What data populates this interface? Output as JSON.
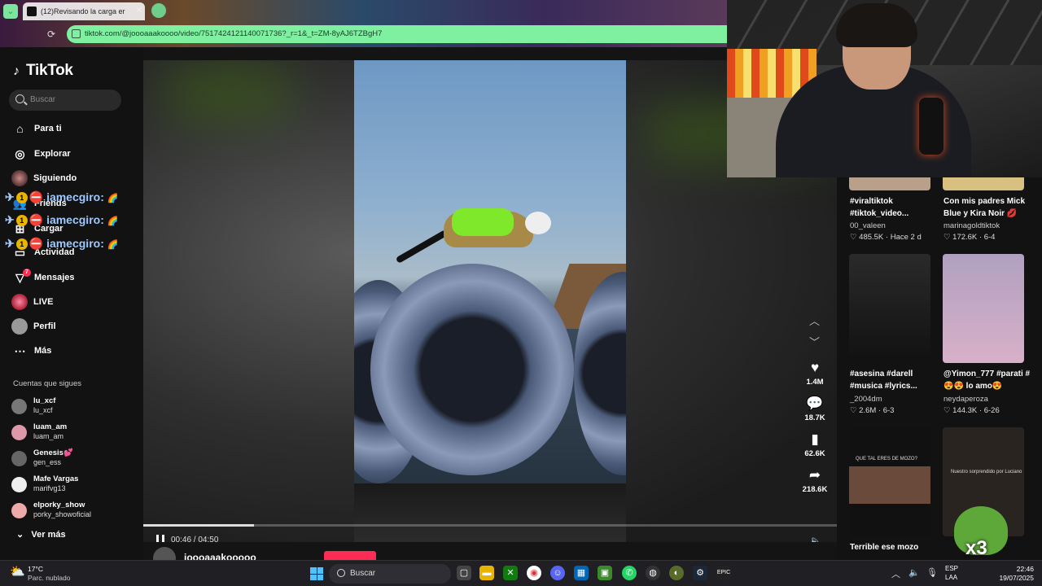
{
  "browser": {
    "tab_title": "(12)Revisando la carga er",
    "url": "tiktok.com/@joooaaakoooo/video/7517424121140071736?_r=1&_t=ZM-8yAJ6TZBgH7"
  },
  "sidebar": {
    "logo": "TikTok",
    "search_placeholder": "Buscar",
    "nav": [
      {
        "label": "Para ti",
        "icon": "home-icon"
      },
      {
        "label": "Explorar",
        "icon": "compass-icon"
      },
      {
        "label": "Siguiendo",
        "icon": "following-avatar"
      },
      {
        "label": "Friends",
        "icon": "friends-icon"
      },
      {
        "label": "Cargar",
        "icon": "upload-icon"
      },
      {
        "label": "Actividad",
        "icon": "activity-icon"
      },
      {
        "label": "Mensajes",
        "icon": "messages-icon",
        "badge": "7"
      },
      {
        "label": "LIVE",
        "icon": "live-avatar"
      },
      {
        "label": "Perfil",
        "icon": "profile-avatar"
      },
      {
        "label": "Más",
        "icon": "more-icon"
      }
    ],
    "following_header": "Cuentas que sigues",
    "following": [
      {
        "name": "lu_xcf",
        "handle": "lu_xcf"
      },
      {
        "name": "luam_am",
        "handle": "luam_am"
      },
      {
        "name": "Genesis💕",
        "handle": "gen_ess"
      },
      {
        "name": "Mafe Vargas",
        "handle": "marifvg13"
      },
      {
        "name": "elporky_show",
        "handle": "porky_showoficial"
      }
    ],
    "see_more": "Ver más"
  },
  "chat_overlay": {
    "lines": [
      "iamecgiro:",
      "iamecgiro:",
      "iamecgiro:"
    ]
  },
  "video": {
    "time": "00:46 / 04:50",
    "progress": 0.16,
    "likes": "1.4M",
    "comments": "18.7K",
    "saves": "62.6K",
    "shares": "218.6K",
    "author": "joooaaakooooo"
  },
  "recommended": [
    {
      "title": "#viraltiktok #tiktok_video...",
      "user": "00_valeen",
      "likes": "485.5K",
      "date": "Hace 2 d"
    },
    {
      "title": "Con mis padres Mick Blue y Kira Noir 💋",
      "user": "marinagoldtiktok",
      "likes": "172.6K",
      "date": "6-4"
    },
    {
      "title": "#asesina #darell #musica #lyrics...",
      "user": "_2004dm",
      "likes": "2.6M",
      "date": "6-3"
    },
    {
      "title": "@Yimon_777 #parati #😍😍 lo amo😍",
      "user": "neydaperoza",
      "likes": "144.3K",
      "date": "6-26"
    },
    {
      "title": "Terrible ese mozo",
      "user": "",
      "likes": "",
      "date": ""
    },
    {
      "title": "",
      "user": "",
      "likes": "",
      "date": ""
    }
  ],
  "thumb_texts": {
    "t5": "QUE TAL ERES DE MOZO?",
    "t6": "Nuestro sorprendido por Luciano"
  },
  "webcam_overlay": "x3",
  "taskbar": {
    "temp": "17°C",
    "weather": "Parc. nublado",
    "search": "Buscar",
    "lang1": "ESP",
    "lang2": "LAA",
    "time": "22:46",
    "date": "19/07/2025"
  },
  "colors": {
    "tiktok_red": "#fe2c55",
    "address_bar": "#7ff0a0",
    "sidebar_bg": "#121212"
  }
}
